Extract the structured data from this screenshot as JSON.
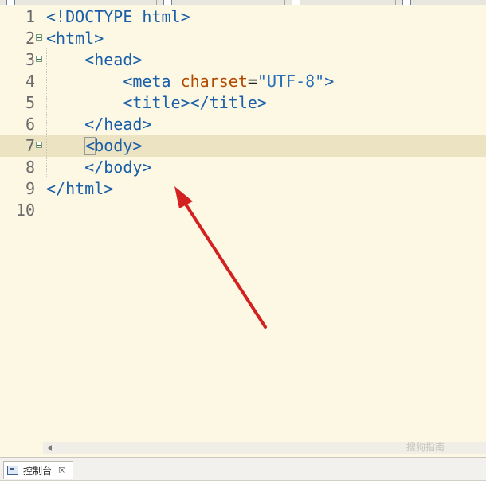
{
  "editor": {
    "lines": [
      {
        "num": "1",
        "indent": "",
        "tokens": [
          {
            "t": "<!DOCTYPE html>",
            "c": "tag"
          }
        ]
      },
      {
        "num": "2",
        "indent": "",
        "fold": true,
        "tokens": [
          {
            "t": "<html>",
            "c": "tag"
          }
        ]
      },
      {
        "num": "3",
        "indent": "    ",
        "fold": true,
        "tokens": [
          {
            "t": "<head>",
            "c": "tag"
          }
        ]
      },
      {
        "num": "4",
        "indent": "        ",
        "tokens": [
          {
            "t": "<meta ",
            "c": "tag"
          },
          {
            "t": "charset",
            "c": "attr"
          },
          {
            "t": "=",
            "c": "plain"
          },
          {
            "t": "\"UTF-8\"",
            "c": "val"
          },
          {
            "t": ">",
            "c": "tag"
          }
        ]
      },
      {
        "num": "5",
        "indent": "        ",
        "tokens": [
          {
            "t": "<title></title>",
            "c": "tag"
          }
        ]
      },
      {
        "num": "6",
        "indent": "    ",
        "tokens": [
          {
            "t": "</head>",
            "c": "tag"
          }
        ]
      },
      {
        "num": "7",
        "indent": "    ",
        "fold": true,
        "highlighted": true,
        "caret": true,
        "tokens": [
          {
            "t": "<body>",
            "c": "tag"
          }
        ]
      },
      {
        "num": "8",
        "indent": "    ",
        "tokens": [
          {
            "t": "</body>",
            "c": "tag"
          }
        ]
      },
      {
        "num": "9",
        "indent": "",
        "tokens": [
          {
            "t": "</html>",
            "c": "tag"
          }
        ]
      },
      {
        "num": "10",
        "indent": "",
        "tokens": []
      }
    ]
  },
  "colors": {
    "background": "#fdf8e4",
    "current_line": "#ece3c3",
    "tag": "#1a5fa8",
    "attribute": "#b24a00",
    "value": "#2a6fb8",
    "annotation_arrow": "#d32020"
  },
  "console": {
    "label": "控制台",
    "close": "☒",
    "icon": "console-icon"
  },
  "watermark": "搜狗指南"
}
